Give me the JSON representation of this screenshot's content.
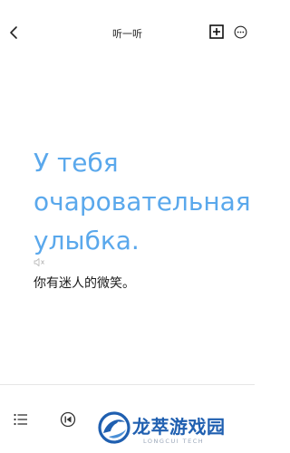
{
  "header": {
    "title": "听一听",
    "back_icon": "chevron-left-icon",
    "add_icon": "plus-square-icon",
    "more_icon": "more-circle-icon"
  },
  "lesson": {
    "sentence_lines": [
      "У тебя",
      "очаровательная",
      "улыбка."
    ],
    "speaker_icon": "speaker-icon",
    "translation": "你有迷人的微笑。",
    "accent_color": "#5aa8ec"
  },
  "player": {
    "list_icon": "list-icon",
    "prev_icon": "previous-icon"
  },
  "watermark": {
    "name": "龙萃游戏园",
    "subtitle": "LONGCUI TECH",
    "brand_color": "#1f5fb0"
  }
}
